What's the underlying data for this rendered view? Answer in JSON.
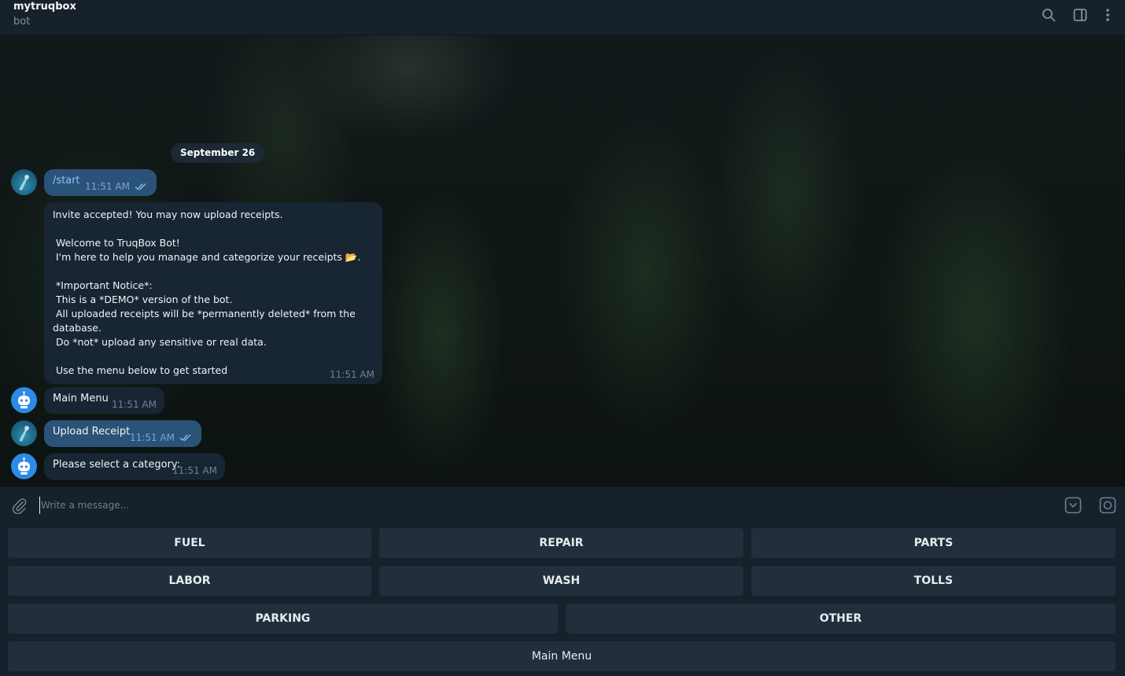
{
  "header": {
    "title": "mytruqbox",
    "subtitle": "bot"
  },
  "chat": {
    "date": "September 26",
    "messages": [
      {
        "text": "/start",
        "time": "11:51 AM"
      },
      {
        "text": "Invite accepted! You may now upload receipts.\n\n Welcome to TruqBox Bot!\n I'm here to help you manage and categorize your receipts 📂.\n\n *Important Notice*:\n This is a *DEMO* version of the bot.\n All uploaded receipts will be *permanently deleted* from the database.\n Do *not* upload any sensitive or real data.\n\n Use the menu below to get started",
        "time": "11:51 AM"
      },
      {
        "text": "Main Menu",
        "time": "11:51 AM"
      },
      {
        "text": "Upload Receipt",
        "time": "11:51 AM"
      },
      {
        "text": "Please select a category:",
        "time": "11:51 AM"
      }
    ]
  },
  "composer": {
    "placeholder": "Write a message..."
  },
  "keyboard": {
    "buttons": [
      "FUEL",
      "REPAIR",
      "PARTS",
      "LABOR",
      "WASH",
      "TOLLS",
      "PARKING",
      "OTHER",
      "Main Menu"
    ]
  }
}
